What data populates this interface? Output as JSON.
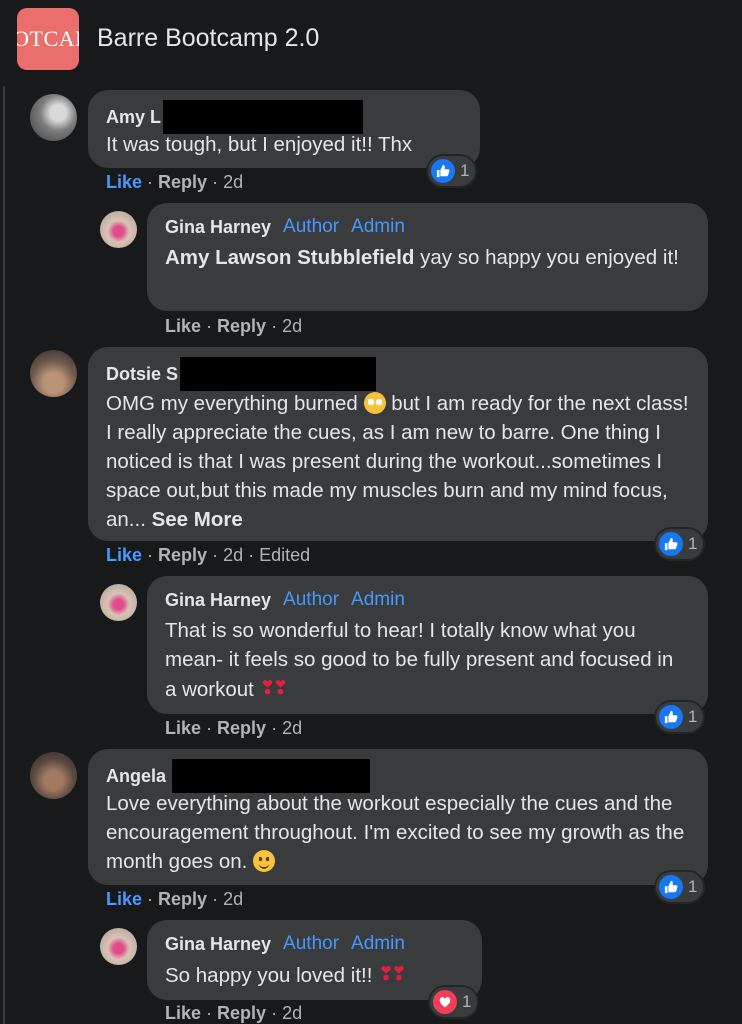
{
  "header": {
    "group_title": "Barre Bootcamp 2.0",
    "logo_text": "OTCAI"
  },
  "comments": [
    {
      "author": "Amy L",
      "text": "It was tough, but I enjoyed it!! Thx",
      "actions": {
        "like": "Like",
        "reply": "Reply",
        "time": "2d"
      },
      "reactions": {
        "type": "like",
        "count": "1"
      },
      "replies": [
        {
          "author": "Gina Harney",
          "badges": [
            "Author",
            "Admin"
          ],
          "mention": "Amy Lawson Stubblefield",
          "text": " yay so happy you enjoyed it!",
          "actions": {
            "like": "Like",
            "reply": "Reply",
            "time": "2d"
          }
        }
      ]
    },
    {
      "author": "Dotsie S",
      "text_part1": "OMG my everything burned ",
      "text_part2": " but I am ready for the next class! I really appreciate the cues, as I am new to barre. One thing I noticed is that I was present during the workout...sometimes I space out,but this made my muscles burn and my mind focus, an... ",
      "see_more": "See More",
      "emoji": "flushed-face-emoji",
      "actions": {
        "like": "Like",
        "reply": "Reply",
        "time": "2d",
        "edited": "Edited"
      },
      "reactions": {
        "type": "like",
        "count": "1"
      },
      "replies": [
        {
          "author": "Gina Harney",
          "badges": [
            "Author",
            "Admin"
          ],
          "text": "That is so wonderful to hear! I totally know what you mean- it feels so good to be fully present and focused in a workout ",
          "hearts": "❣❣",
          "actions": {
            "like": "Like",
            "reply": "Reply",
            "time": "2d"
          },
          "reactions": {
            "type": "like",
            "count": "1"
          }
        }
      ]
    },
    {
      "author": "Angela",
      "text": "Love everything about the workout especially the cues and the encouragement throughout. I'm excited to see my growth as the month goes on. ",
      "emoji": "smiling-face-emoji",
      "actions": {
        "like": "Like",
        "reply": "Reply",
        "time": "2d"
      },
      "reactions": {
        "type": "like",
        "count": "1"
      },
      "replies": [
        {
          "author": "Gina Harney",
          "badges": [
            "Author",
            "Admin"
          ],
          "text": "So happy you loved it!! ",
          "hearts": "❣❣",
          "actions": {
            "like": "Like",
            "reply": "Reply",
            "time": "2d"
          },
          "reactions": {
            "type": "love",
            "count": "1"
          }
        }
      ]
    }
  ],
  "colors": {
    "background": "#18191a",
    "bubble": "#3a3b3c",
    "link_blue": "#4599ff",
    "like_blue": "#1877f2",
    "love_red": "#f33e58"
  },
  "icons": {
    "like": "thumbs-up-icon",
    "love": "heart-icon"
  }
}
